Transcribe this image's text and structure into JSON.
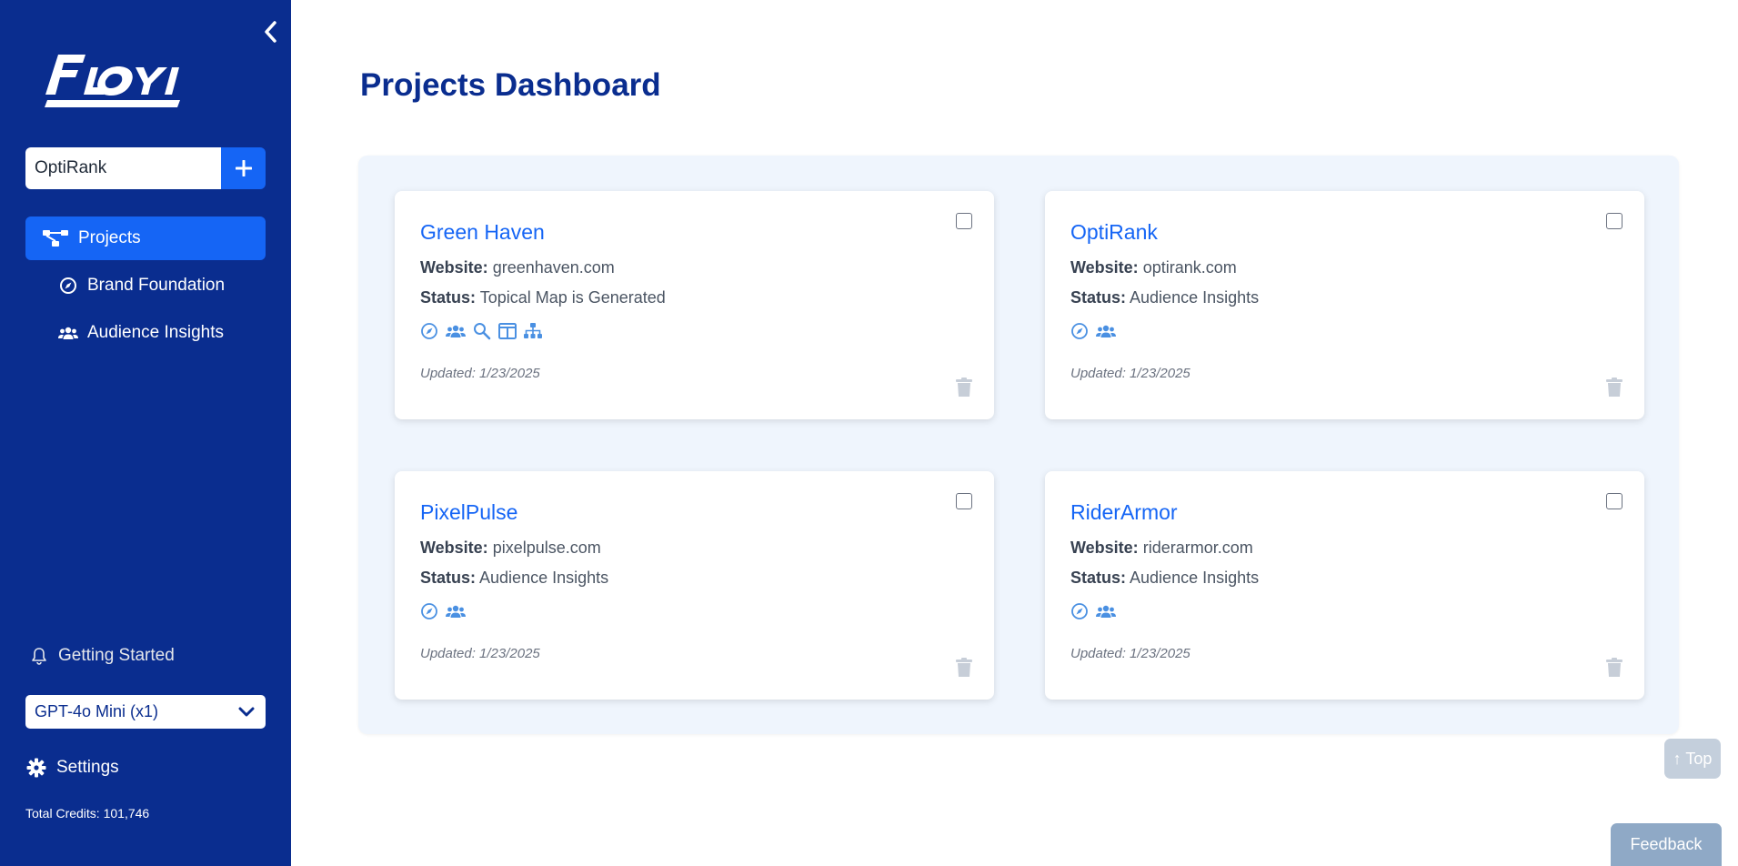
{
  "app": {
    "name": "FLOYI"
  },
  "sidebar": {
    "project_picker": {
      "value": "OptiRank"
    },
    "nav": [
      {
        "label": "Projects",
        "icon": "sitemap-icon",
        "active": true
      },
      {
        "label": "Brand Foundation",
        "icon": "compass-icon"
      },
      {
        "label": "Audience Insights",
        "icon": "users-icon"
      }
    ],
    "getting_started_label": "Getting Started",
    "model_select_value": "GPT-4o Mini (x1)",
    "settings_label": "Settings",
    "credits_text": "Total Credits: 101,746"
  },
  "main": {
    "title": "Projects Dashboard",
    "website_label": "Website:",
    "status_label": "Status:",
    "projects": [
      {
        "name": "Green Haven",
        "website": "greenhaven.com",
        "status": "Topical Map is Generated",
        "updated": "Updated: 1/23/2025",
        "icons": [
          "compass-icon",
          "users-icon",
          "search-icon",
          "columns-icon",
          "sitemap-icon"
        ]
      },
      {
        "name": "OptiRank",
        "website": "optirank.com",
        "status": "Audience Insights",
        "updated": "Updated: 1/23/2025",
        "icons": [
          "compass-icon",
          "users-icon"
        ]
      },
      {
        "name": "PixelPulse",
        "website": "pixelpulse.com",
        "status": "Audience Insights",
        "updated": "Updated: 1/23/2025",
        "icons": [
          "compass-icon",
          "users-icon"
        ]
      },
      {
        "name": "RiderArmor",
        "website": "riderarmor.com",
        "status": "Audience Insights",
        "updated": "Updated: 1/23/2025",
        "icons": [
          "compass-icon",
          "users-icon"
        ]
      }
    ]
  },
  "floating": {
    "top_label": "↑ Top",
    "feedback_label": "Feedback"
  },
  "colors": {
    "sidebar_bg": "#0a2d8f",
    "accent": "#1565f5",
    "panel_bg": "#eff5fd",
    "title": "#0a2d8f"
  }
}
